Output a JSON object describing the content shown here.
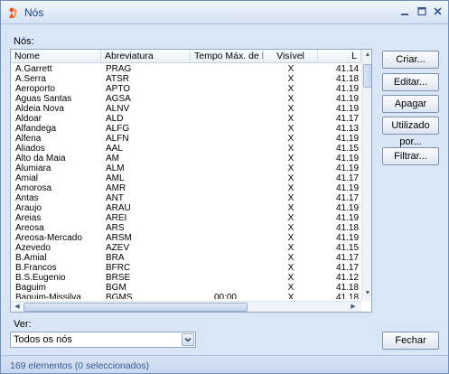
{
  "window": {
    "title": "Nós"
  },
  "list": {
    "label": "Nós:",
    "columns": [
      "Nome",
      "Abreviatura",
      "Tempo Máx. de Pa",
      "Visível",
      "L"
    ],
    "rows": [
      [
        "A.Garrett",
        "PRAG",
        "",
        "X",
        "41.14"
      ],
      [
        "A.Serra",
        "ATSR",
        "",
        "X",
        "41.18"
      ],
      [
        "Aeroporto",
        "APTO",
        "",
        "X",
        "41.19"
      ],
      [
        "Aguas Santas",
        "AGSA",
        "",
        "X",
        "41.19"
      ],
      [
        "Aldeia Nova",
        "ALNV",
        "",
        "X",
        "41.19"
      ],
      [
        "Aldoar",
        "ALD",
        "",
        "X",
        "41.17"
      ],
      [
        "Alfandega",
        "ALFG",
        "",
        "X",
        "41.13"
      ],
      [
        "Alfena",
        "ALFN",
        "",
        "X",
        "41.19"
      ],
      [
        "Aliados",
        "AAL",
        "",
        "X",
        "41.15"
      ],
      [
        "Alto da Maia",
        "AM",
        "",
        "X",
        "41.19"
      ],
      [
        "Alumiara",
        "ALM",
        "",
        "X",
        "41.19"
      ],
      [
        "Amial",
        "AML",
        "",
        "X",
        "41.17"
      ],
      [
        "Amorosa",
        "AMR",
        "",
        "X",
        "41.19"
      ],
      [
        "Antas",
        "ANT",
        "",
        "X",
        "41.17"
      ],
      [
        "Araujo",
        "ARAU",
        "",
        "X",
        "41.19"
      ],
      [
        "Areias",
        "AREI",
        "",
        "X",
        "41.19"
      ],
      [
        "Areosa",
        "ARS",
        "",
        "X",
        "41.18"
      ],
      [
        "Areosa-Mercado",
        "ARSM",
        "",
        "X",
        "41.19"
      ],
      [
        "Azevedo",
        "AZEV",
        "",
        "X",
        "41.15"
      ],
      [
        "B.Amial",
        "BRA",
        "",
        "X",
        "41.17"
      ],
      [
        "B.Francos",
        "BFRC",
        "",
        "X",
        "41.17"
      ],
      [
        "B.S.Eugenio",
        "BRSE",
        "",
        "X",
        "41.12"
      ],
      [
        "Baguim",
        "BGM",
        "",
        "X",
        "41.18"
      ],
      [
        "Baguim-Missilva",
        "BGMS",
        "00:00",
        "X",
        "41.18"
      ]
    ]
  },
  "buttons": {
    "criar": "Criar...",
    "editar": "Editar...",
    "apagar": "Apagar",
    "utilizado": "Utilizado por...",
    "filtrar": "Filtrar...",
    "fechar": "Fechar"
  },
  "ver": {
    "label": "Ver:",
    "selected": "Todos os nós"
  },
  "status": {
    "text": "169 elementos (0 seleccionados)"
  },
  "colors": {
    "accent": "#1e3d7a",
    "window_bg": "#d9e6f6",
    "status_text": "#3a5a91"
  },
  "icons": {
    "app": "app-icon",
    "minimize": "minimize-icon",
    "maximize": "maximize-icon",
    "close": "close-icon",
    "dropdown": "chevron-down-icon"
  }
}
